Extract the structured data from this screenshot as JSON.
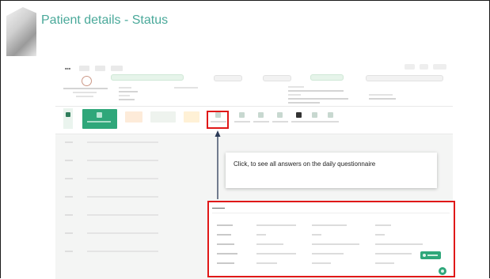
{
  "slide": {
    "title": "Patient details - Status"
  },
  "callout": {
    "text": "Click, to see all answers on the daily questionnaire"
  },
  "colors": {
    "title": "#4aa99a",
    "accent": "#2fa77a",
    "highlight": "#e01818"
  }
}
